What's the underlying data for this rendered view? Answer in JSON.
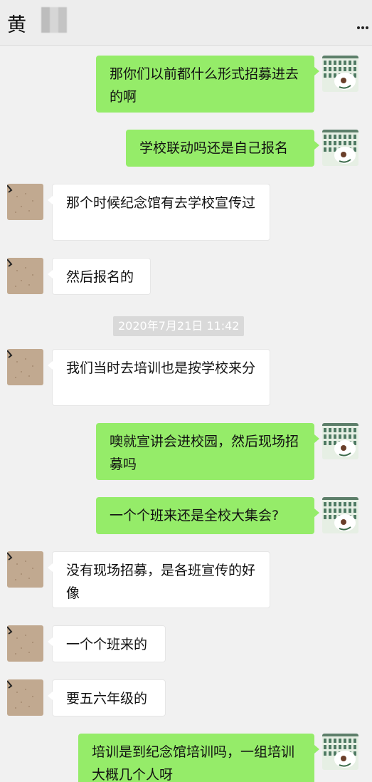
{
  "header": {
    "contact_name": "黄",
    "more_icon": "more-dots-icon"
  },
  "timestamp": "2020年7月21日 11:42",
  "messages": [
    {
      "from": "me",
      "text": "那你们以前都什么形式招募进去的啊"
    },
    {
      "from": "me",
      "text": "学校联动吗还是自己报名"
    },
    {
      "from": "them",
      "text": "那个时候纪念馆有去学校宣传过"
    },
    {
      "from": "them",
      "text": "然后报名的"
    },
    {
      "from": "them",
      "text": "我们当时去培训也是按学校来分"
    },
    {
      "from": "me",
      "text": "噢就宣讲会进校园，然后现场招募吗"
    },
    {
      "from": "me",
      "text": "一个个班来还是全校大集会?"
    },
    {
      "from": "them",
      "text": "没有现场招募，是各班宣传的好像"
    },
    {
      "from": "them",
      "text": "一个个班来的"
    },
    {
      "from": "them",
      "text": "要五六年级的"
    },
    {
      "from": "me",
      "text": "培训是到纪念馆培训吗，一组培训大概几个人呀"
    }
  ],
  "colors": {
    "outgoing_bubble": "#95ec69",
    "incoming_bubble": "#ffffff",
    "background": "#f1f1f1"
  }
}
